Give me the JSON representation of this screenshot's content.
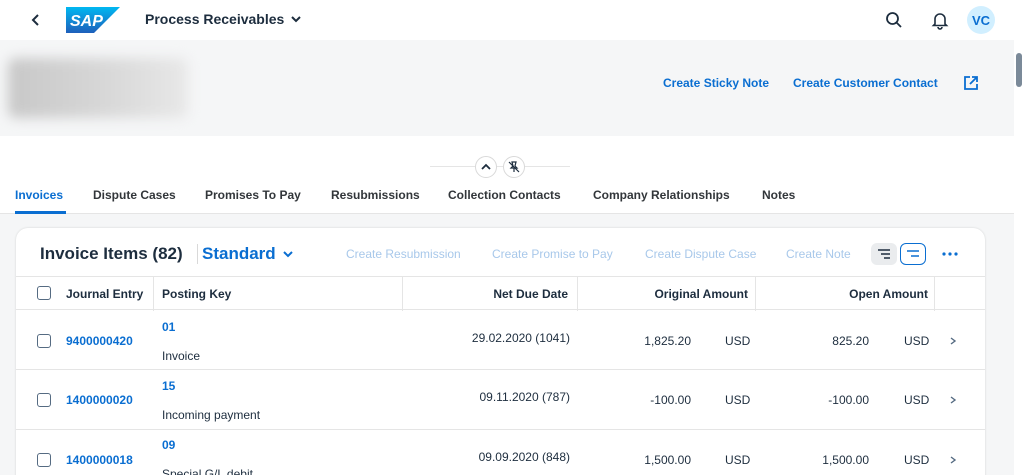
{
  "shell": {
    "logo_text": "SAP",
    "app_title": "Process Receivables",
    "avatar_initials": "VC",
    "colors": {
      "brand": "#0a6ed1",
      "avatar_bg": "#d1efff"
    }
  },
  "header": {
    "actions": [
      "Create Sticky Note",
      "Create Customer Contact"
    ]
  },
  "tabs": [
    {
      "label": "Invoices",
      "active": true
    },
    {
      "label": "Dispute Cases"
    },
    {
      "label": "Promises To Pay"
    },
    {
      "label": "Resubmissions"
    },
    {
      "label": "Collection Contacts"
    },
    {
      "label": "Company Relationships"
    },
    {
      "label": "Notes"
    }
  ],
  "table": {
    "title": "Invoice Items (82)",
    "variant": "Standard",
    "toolbar_buttons": [
      "Create Resubmission",
      "Create Promise to Pay",
      "Create Dispute Case",
      "Create Note"
    ],
    "columns": [
      "Journal Entry",
      "Posting Key",
      "Net Due Date",
      "Original Amount",
      "Open Amount"
    ],
    "rows": [
      {
        "journal_entry": "9400000420",
        "posting_key": "01",
        "posting_desc": "Invoice",
        "net_due_date": "29.02.2020 (1041)",
        "original_amount": "1,825.20",
        "original_currency": "USD",
        "open_amount": "825.20",
        "open_currency": "USD"
      },
      {
        "journal_entry": "1400000020",
        "posting_key": "15",
        "posting_desc": "Incoming payment",
        "net_due_date": "09.11.2020 (787)",
        "original_amount": "-100.00",
        "original_currency": "USD",
        "open_amount": "-100.00",
        "open_currency": "USD"
      },
      {
        "journal_entry": "1400000018",
        "posting_key": "09",
        "posting_desc": "Special G/L debit",
        "net_due_date": "09.09.2020 (848)",
        "original_amount": "1,500.00",
        "original_currency": "USD",
        "open_amount": "1,500.00",
        "open_currency": "USD"
      }
    ]
  }
}
